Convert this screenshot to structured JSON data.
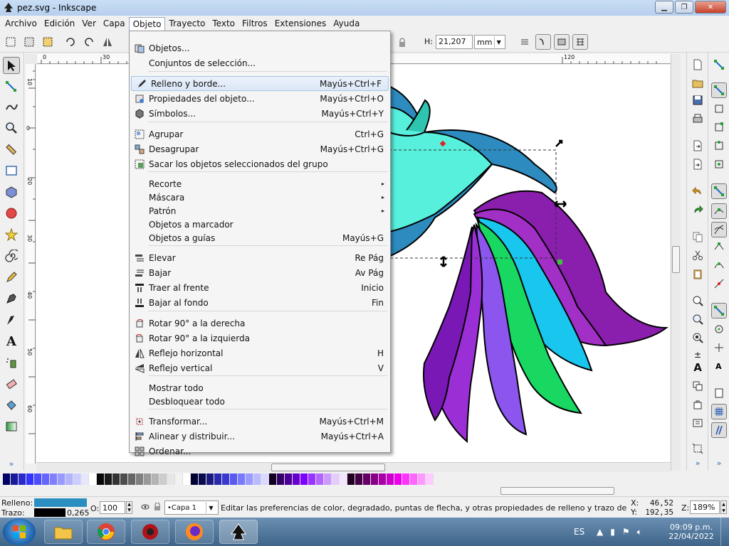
{
  "window": {
    "title": "pez.svg - Inkscape"
  },
  "menubar": [
    "Archivo",
    "Edición",
    "Ver",
    "Capa",
    "Objeto",
    "Trayecto",
    "Texto",
    "Filtros",
    "Extensiones",
    "Ayuda"
  ],
  "toolbar": {
    "h_label": "H:",
    "h_value": "21,207",
    "unit": "mm"
  },
  "dropdown": [
    {
      "label": "Objetos...",
      "shortcut": "",
      "icon": "objects-icon"
    },
    {
      "label": "Conjuntos de selección...",
      "shortcut": "",
      "icon": ""
    },
    {
      "label": "Relleno y borde...",
      "shortcut": "Mayús+Ctrl+F",
      "icon": "fill-stroke-icon"
    },
    {
      "label": "Propiedades del objeto...",
      "shortcut": "Mayús+Ctrl+O",
      "icon": "object-properties-icon"
    },
    {
      "label": "Símbolos...",
      "shortcut": "Mayús+Ctrl+Y",
      "icon": "symbols-icon"
    },
    {
      "label": "Agrupar",
      "shortcut": "Ctrl+G",
      "icon": "group-icon"
    },
    {
      "label": "Desagrupar",
      "shortcut": "Mayús+Ctrl+G",
      "icon": "ungroup-icon"
    },
    {
      "label": "Sacar los objetos seleccionados del grupo",
      "shortcut": "",
      "icon": "pop-from-group-icon"
    },
    {
      "label": "Recorte",
      "shortcut": "",
      "icon": "",
      "submenu": "▸"
    },
    {
      "label": "Máscara",
      "shortcut": "",
      "icon": "",
      "submenu": "▸"
    },
    {
      "label": "Patrón",
      "shortcut": "",
      "icon": "",
      "submenu": "▸"
    },
    {
      "label": "Objetos a marcador",
      "shortcut": "",
      "icon": ""
    },
    {
      "label": "Objetos a guías",
      "shortcut": "Mayús+G",
      "icon": ""
    },
    {
      "label": "Elevar",
      "shortcut": "Re Pág",
      "icon": "raise-icon"
    },
    {
      "label": "Bajar",
      "shortcut": "Av Pág",
      "icon": "lower-icon"
    },
    {
      "label": "Traer al frente",
      "shortcut": "Inicio",
      "icon": "raise-to-top-icon"
    },
    {
      "label": "Bajar al fondo",
      "shortcut": "Fin",
      "icon": "lower-to-bottom-icon"
    },
    {
      "label": "Rotar 90° a la derecha",
      "shortcut": "",
      "icon": "rotate-cw-icon"
    },
    {
      "label": "Rotar 90° a la izquierda",
      "shortcut": "",
      "icon": "rotate-ccw-icon"
    },
    {
      "label": "Reflejo horizontal",
      "shortcut": "H",
      "icon": "flip-horizontal-icon"
    },
    {
      "label": "Reflejo vertical",
      "shortcut": "V",
      "icon": "flip-vertical-icon"
    },
    {
      "label": "Mostrar todo",
      "shortcut": "",
      "icon": ""
    },
    {
      "label": "Desbloquear todo",
      "shortcut": "",
      "icon": ""
    },
    {
      "label": "Transformar...",
      "shortcut": "Mayús+Ctrl+M",
      "icon": "transform-icon"
    },
    {
      "label": "Alinear y distribuir...",
      "shortcut": "Mayús+Ctrl+A",
      "icon": "align-icon"
    },
    {
      "label": "Ordenar...",
      "shortcut": "",
      "icon": "arrange-icon"
    }
  ],
  "status": {
    "fill_label": "Relleno:",
    "stroke_label": "Trazo:",
    "stroke_width": "0,265",
    "opacity_label": "O:",
    "opacity_value": "100",
    "layer": "•Capa 1",
    "message": "Editar las preferencias de color, degradado, puntas de flecha, y otras propiedades de relleno y trazo de un o...",
    "x_label": "X:",
    "x_value": "46,52",
    "y_label": "Y:",
    "y_value": "192,35",
    "zoom_label": "Z:",
    "zoom_value": "189%"
  },
  "taskbar": {
    "lang": "ES",
    "time": "09:09 p.m.",
    "date": "22/04/2022"
  },
  "rulers": {
    "top_ticks": [
      "0",
      "30",
      "120"
    ],
    "top_tick_label_2": "120",
    "left_ticks": [
      "10",
      "0",
      "20",
      "30",
      "40",
      "50",
      "60"
    ]
  },
  "colors": {
    "fill_swatch": "#2a8fc0",
    "stroke_swatch": "#000000",
    "accent": "#3a78c2"
  }
}
